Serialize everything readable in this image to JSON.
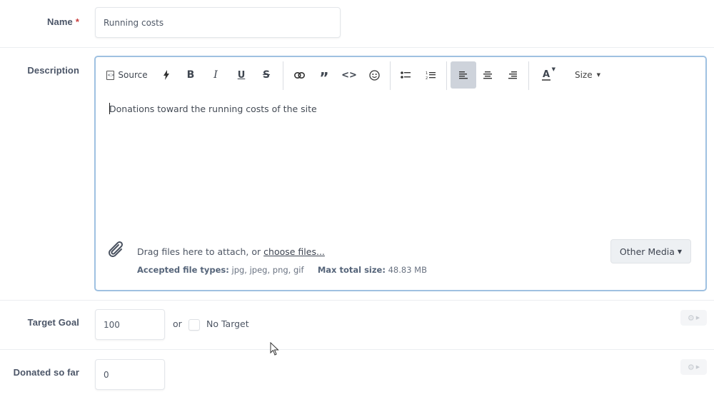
{
  "fields": {
    "name": {
      "label": "Name",
      "required_marker": "*",
      "value": "Running costs"
    },
    "description": {
      "label": "Description",
      "toolbar": {
        "source": "Source",
        "bold": "B",
        "italic": "I",
        "underline": "U",
        "strike": "S",
        "quote": "”",
        "code": "<>",
        "size": "Size",
        "font_color": "A"
      },
      "content": "Donations toward the running costs of the site",
      "attach": {
        "prompt": "Drag files here to attach, or ",
        "choose_link": "choose files...",
        "accepted_label": "Accepted file types:",
        "accepted_value": "jpg, jpeg, png, gif",
        "max_label": "Max total size:",
        "max_value": "48.83 MB"
      },
      "other_media": "Other Media"
    },
    "target_goal": {
      "label": "Target Goal",
      "value": "100",
      "or": "or",
      "no_target": "No Target",
      "no_target_checked": false
    },
    "donated": {
      "label": "Donated so far",
      "value": "0"
    }
  },
  "icons": {
    "source": "source-code-file-icon",
    "flash": "lightning-icon",
    "link": "link-icon",
    "quote": "quote-icon",
    "code": "code-icon",
    "smilie": "smiley-icon",
    "bullets": "bulleted-list-icon",
    "numbers": "numbered-list-icon",
    "align_left": "align-left-icon",
    "align_center": "align-center-icon",
    "align_right": "align-right-icon",
    "attach": "paperclip-icon",
    "gear": "gear-icon"
  },
  "colors": {
    "editor_border": "#9fc1e1",
    "required": "#c83c3c",
    "active_tool": "#ced3db"
  }
}
